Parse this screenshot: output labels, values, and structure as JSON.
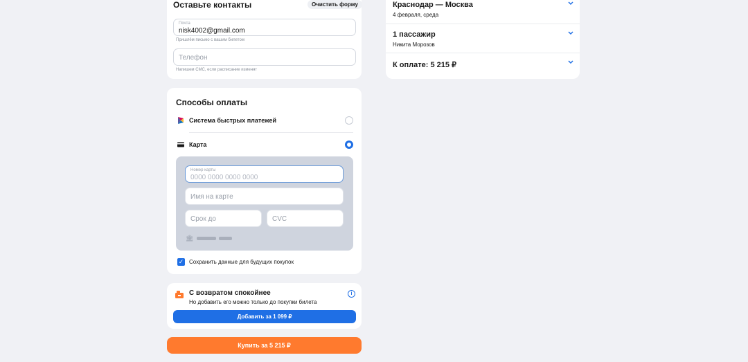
{
  "contacts": {
    "title": "Оставьте контакты",
    "clear_label": "Очистить форму",
    "email": {
      "label": "Почта",
      "value": "nisk4002@gmail.com",
      "hint": "Пришлём письмо с вашим билетом"
    },
    "phone": {
      "placeholder": "Телефон",
      "hint": "Напишем СМС, если расписание изменят"
    }
  },
  "payment": {
    "title": "Способы оплаты",
    "methods": [
      {
        "label": "Система быстрых платежей",
        "selected": false,
        "icon": "sbp-icon"
      },
      {
        "label": "Карта",
        "selected": true,
        "icon": "card-icon"
      }
    ],
    "card_form": {
      "number_label": "Номер карты",
      "number_placeholder": "0000 0000 0000 0000",
      "name_placeholder": "Имя на карте",
      "expiry_placeholder": "Срок до",
      "cvc_placeholder": "CVC",
      "bank_icon": "bank-icon"
    },
    "save_card": {
      "label": "Сохранить данные для будущих покупок",
      "checked": true
    }
  },
  "refund": {
    "title": "С возвратом спокойнее",
    "subtitle": "Но добавить его можно только до покупки билета",
    "add_label": "Добавить за 1 099 ₽",
    "icon": "gift-icon"
  },
  "buy_label": "Купить за 5 215 ₽",
  "summary": {
    "route": "Краснодар — Москва",
    "date": "4 февраля, среда",
    "passengers": "1 пассажир",
    "passenger_name": "Никита Морозов",
    "total": "К оплате: 5 215 ₽"
  },
  "colors": {
    "accent": "#1f6fe5",
    "buy": "#ff7a2e",
    "background": "#f0f1f5",
    "card_form_bg": "#cfd4de"
  }
}
